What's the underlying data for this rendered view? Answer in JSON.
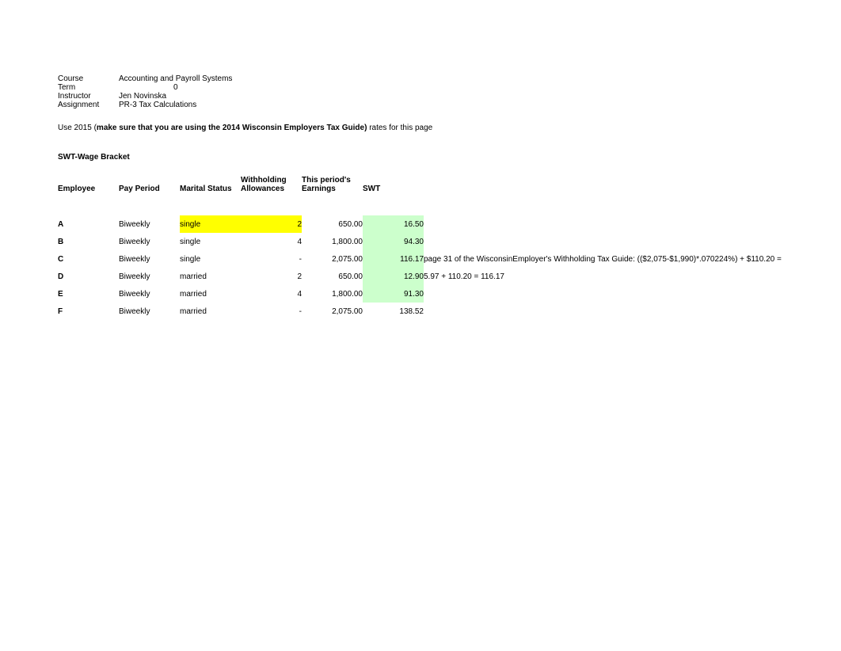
{
  "meta": {
    "course_label": "Course",
    "course_value": "Accounting and Payroll Systems",
    "term_label": "Term",
    "term_value": "0",
    "instructor_label": "Instructor",
    "instructor_value": "Jen Novinska",
    "assignment_label": "Assignment",
    "assignment_value": "PR-3 Tax Calculations"
  },
  "note": {
    "prefix": "Use 2015 (",
    "bold": "make sure that you are using the 2014 Wisconsin Employers Tax Guide)",
    "suffix": " rates for this page"
  },
  "section_title": "SWT-Wage Bracket",
  "headers": {
    "employee": "Employee",
    "pay_period": "Pay Period",
    "marital_status": "Marital Status",
    "withholding_l1": "Withholding",
    "withholding_l2": "Allowances",
    "earnings_l1": "This period's",
    "earnings_l2": "Earnings",
    "swt": "SWT"
  },
  "rows": [
    {
      "emp": "A",
      "pay": "Biweekly",
      "mar": "single",
      "allow": "2",
      "earn": "650.00",
      "swt": "16.50",
      "note": "",
      "mar_hl": "yellow",
      "allow_hl": "yellow",
      "swt_hl": "green"
    },
    {
      "emp": "B",
      "pay": "Biweekly",
      "mar": "single",
      "allow": "4",
      "earn": "1,800.00",
      "swt": "94.30",
      "note": "",
      "mar_hl": "",
      "allow_hl": "",
      "swt_hl": "green"
    },
    {
      "emp": "C",
      "pay": "Biweekly",
      "mar": "single",
      "allow": "-",
      "earn": "2,075.00",
      "swt": "116.17",
      "note": "page 31 of the WisconsinEmployer's Withholding Tax Guide:  (($2,075-$1,990)*.070224%) + $110.20 =",
      "mar_hl": "",
      "allow_hl": "",
      "swt_hl": "green"
    },
    {
      "emp": "D",
      "pay": "Biweekly",
      "mar": "married",
      "allow": "2",
      "earn": "650.00",
      "swt": "12.90",
      "note": "5.97 + 110.20 = 116.17",
      "mar_hl": "",
      "allow_hl": "",
      "swt_hl": "green"
    },
    {
      "emp": "E",
      "pay": "Biweekly",
      "mar": "married",
      "allow": "4",
      "earn": "1,800.00",
      "swt": "91.30",
      "note": "",
      "mar_hl": "",
      "allow_hl": "",
      "swt_hl": "green"
    },
    {
      "emp": "F",
      "pay": "Biweekly",
      "mar": "married",
      "allow": "-",
      "earn": "2,075.00",
      "swt": "138.52",
      "note": "",
      "mar_hl": "",
      "allow_hl": "",
      "swt_hl": ""
    }
  ]
}
